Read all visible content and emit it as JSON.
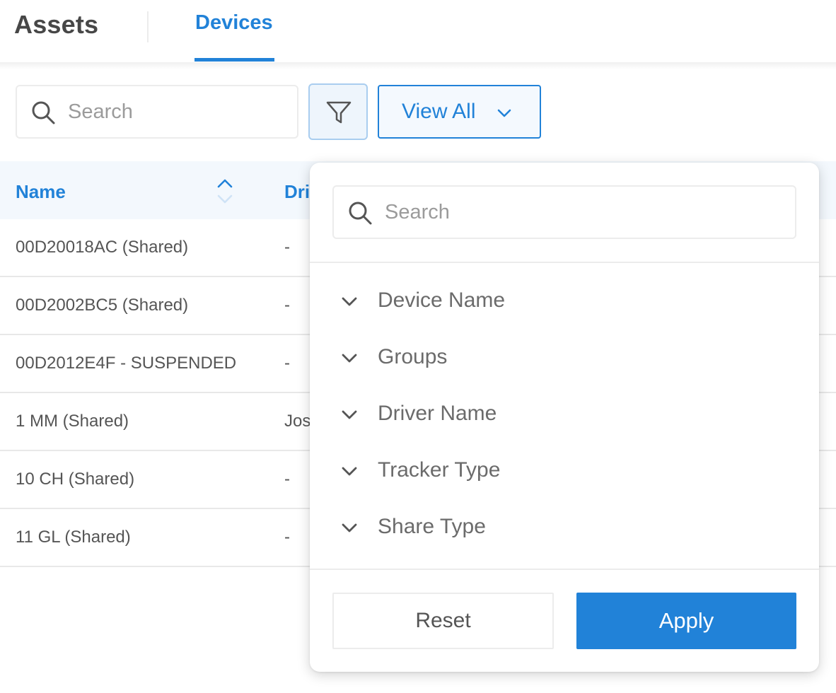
{
  "header": {
    "title": "Assets",
    "tabs": [
      {
        "label": "Devices",
        "active": true
      }
    ]
  },
  "toolbar": {
    "search_placeholder": "Search",
    "search_value": "",
    "filter_icon": "funnel-icon",
    "view_select": {
      "selected": "View All",
      "icon": "chevron-down-icon"
    }
  },
  "table": {
    "columns": [
      {
        "label": "Name",
        "sortable": true
      },
      {
        "label": "Driver Name"
      }
    ],
    "rows": [
      {
        "name": "00D20018AC (Shared)",
        "driver": "-"
      },
      {
        "name": "00D2002BC5 (Shared)",
        "driver": "-"
      },
      {
        "name": "00D2012E4F - SUSPENDED",
        "driver": "-"
      },
      {
        "name": "1 MM (Shared)",
        "driver": "Jos"
      },
      {
        "name": "10 CH (Shared)",
        "driver": "-"
      },
      {
        "name": "11 GL (Shared)",
        "driver": "-"
      }
    ]
  },
  "filter_popover": {
    "search_placeholder": "Search",
    "search_value": "",
    "items": [
      {
        "label": "Device Name"
      },
      {
        "label": "Groups"
      },
      {
        "label": "Driver Name"
      },
      {
        "label": "Tracker Type"
      },
      {
        "label": "Share Type"
      }
    ],
    "reset_label": "Reset",
    "apply_label": "Apply"
  },
  "colors": {
    "accent": "#2182d8",
    "text": "#4a4a4a",
    "muted": "#9b9b9b",
    "table_header_bg": "#f3f8fd"
  }
}
